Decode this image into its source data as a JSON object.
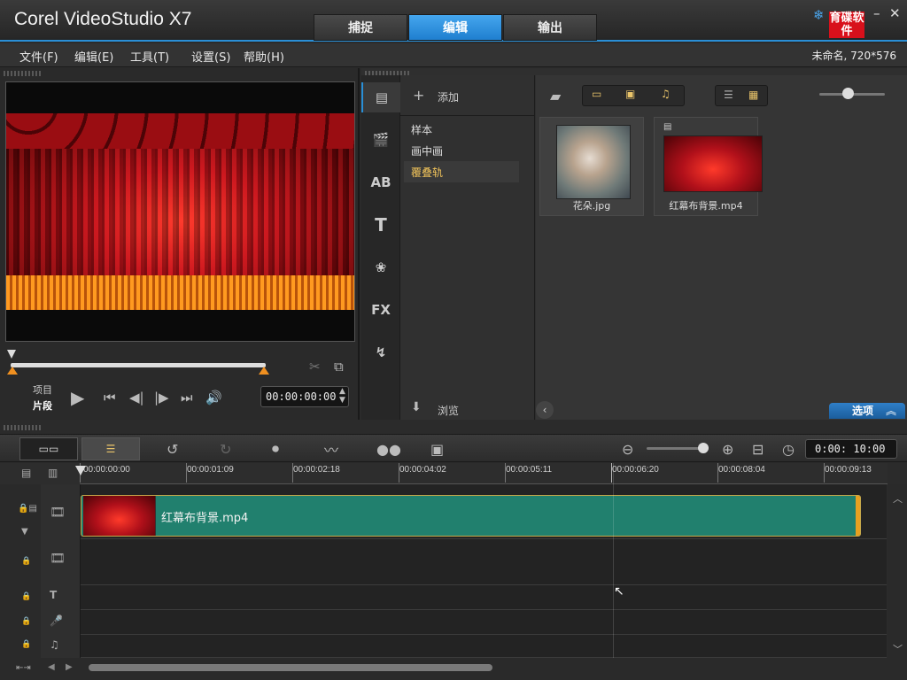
{
  "app": {
    "title": "Corel  VideoStudio X7"
  },
  "main_tabs": [
    {
      "label": "捕捉",
      "active": false
    },
    {
      "label": "编辑",
      "active": true
    },
    {
      "label": "输出",
      "active": false
    }
  ],
  "logo": {
    "text": "育碟软件"
  },
  "menu": {
    "items": [
      "文件(F)",
      "编辑(E)",
      "工具(T)",
      "设置(S)",
      "帮助(H)"
    ],
    "project_info": "未命名, 720*576"
  },
  "player": {
    "labels": {
      "project": "项目",
      "clip": "片段"
    },
    "timecode": "00:00:00:00"
  },
  "library": {
    "add_label": "添加",
    "categories": [
      "样本",
      "画中画",
      "覆叠轨"
    ],
    "selected_category": "覆叠轨",
    "browse_label": "浏览",
    "options_label": "选项",
    "media": [
      {
        "name": "花朵.jpg",
        "type": "image"
      },
      {
        "name": "红幕布背景.mp4",
        "type": "video"
      }
    ]
  },
  "timeline": {
    "zoom_time": "0:00: 10:00",
    "ticks": [
      "00:00:00:00",
      "00:00:01:09",
      "00:00:02:18",
      "00:00:04:02",
      "00:00:05:11",
      "00:00:06:20",
      "00:00:08:04",
      "00:00:09:13"
    ],
    "clip": {
      "name": "红幕布背景.mp4"
    }
  },
  "colors": {
    "accent": "#2a8fd6",
    "clip": "#21806e",
    "selected_cat": "#f0c35a"
  }
}
